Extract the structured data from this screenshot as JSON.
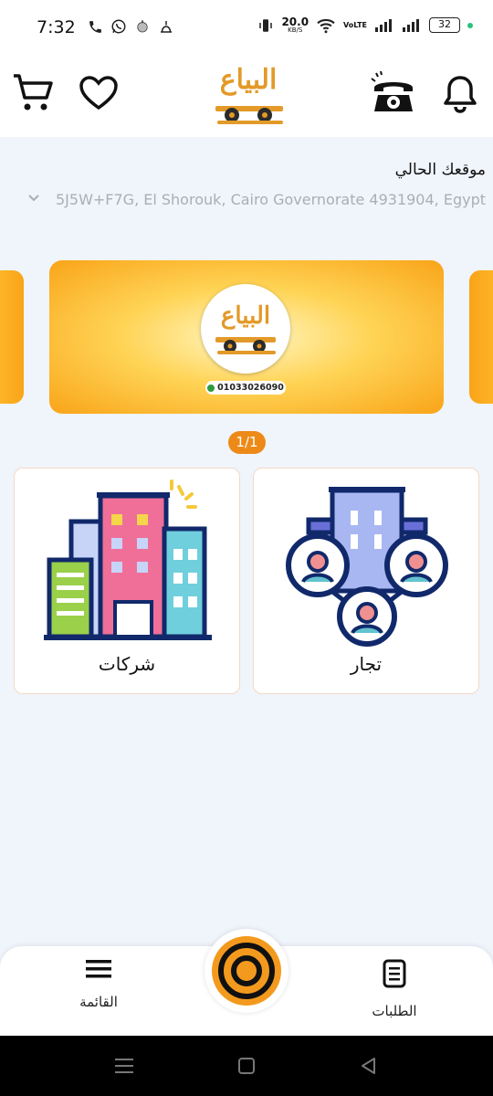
{
  "status_bar": {
    "time": "7:32",
    "net_speed": "20.0",
    "net_unit": "KB/S",
    "volte": "VoLTE",
    "battery": "32"
  },
  "header": {
    "logo_text": "البياع",
    "icons": [
      "cart-icon",
      "heart-icon",
      "phone-icon",
      "bell-icon"
    ]
  },
  "location": {
    "title": "موقعك الحالي",
    "address": "5J5W+F7G, El Shorouk, Cairo Governorate 4931904, Egypt"
  },
  "banner": {
    "logo_text": "البياع",
    "phone": "01033026090",
    "pager": "1/1"
  },
  "cards": [
    {
      "label": "تجار",
      "icon": "merchants-icon"
    },
    {
      "label": "شركات",
      "icon": "companies-icon"
    }
  ],
  "bottom_nav": {
    "orders_label": "الطلبات",
    "menu_label": "القائمة"
  },
  "colors": {
    "accent": "#ED8A17",
    "background": "#F0F4FB",
    "card_border": "#F4D9C5"
  }
}
